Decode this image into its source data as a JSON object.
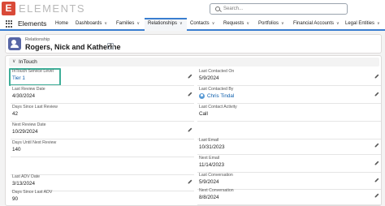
{
  "brand": {
    "logo_letter": "E",
    "logo_text": "ELEMENTS",
    "app_name": "Elements"
  },
  "search": {
    "placeholder": "Search..."
  },
  "nav": [
    {
      "label": "Home",
      "has_menu": false,
      "active": false
    },
    {
      "label": "Dashboards",
      "has_menu": true,
      "active": false
    },
    {
      "label": "Families",
      "has_menu": true,
      "active": false
    },
    {
      "label": "Relationships",
      "has_menu": true,
      "active": true
    },
    {
      "label": "Contacts",
      "has_menu": true,
      "active": false
    },
    {
      "label": "Requests",
      "has_menu": true,
      "active": false
    },
    {
      "label": "Portfolios",
      "has_menu": true,
      "active": false
    },
    {
      "label": "Financial Accounts",
      "has_menu": true,
      "active": false
    },
    {
      "label": "Legal Entities",
      "has_menu": true,
      "active": false
    }
  ],
  "record": {
    "type": "Relationship",
    "title": "Rogers, Nick and Katherine",
    "hierarchy_label": "A"
  },
  "section": {
    "label": "InTouch"
  },
  "left_fields": [
    {
      "label": "InTouch Service Level",
      "value": "Tier 1",
      "link": true,
      "editable": true
    },
    {
      "label": "Last Review Date",
      "value": "4/30/2024",
      "link": false,
      "editable": true
    },
    {
      "label": "Days Since Last Review",
      "value": "42",
      "link": false,
      "editable": false
    },
    {
      "label": "Next Review Date",
      "value": "10/29/2024",
      "link": false,
      "editable": true
    },
    {
      "label": "Days Until Next Review",
      "value": "140",
      "link": false,
      "editable": false
    },
    {
      "label": "",
      "value": "",
      "link": false,
      "editable": false
    },
    {
      "label": "Last ADV Date",
      "value": "3/13/2024",
      "link": false,
      "editable": true
    },
    {
      "label": "Days Since Last ADV",
      "value": "90",
      "link": false,
      "editable": false
    }
  ],
  "right_fields": [
    {
      "label": "Last Contacted On",
      "value": "5/9/2024",
      "link": false,
      "editable": true
    },
    {
      "label": "Last Contacted By",
      "value": "Chris Tindal",
      "link": true,
      "editable": true,
      "user_icon": true
    },
    {
      "label": "Last Contact Activity",
      "value": "Call",
      "link": false,
      "editable": false
    },
    {
      "label": "",
      "value": "",
      "link": false,
      "editable": false
    },
    {
      "label": "Last Email",
      "value": "10/31/2023",
      "link": false,
      "editable": true
    },
    {
      "label": "Next Email",
      "value": "11/14/2023",
      "link": false,
      "editable": true
    },
    {
      "label": "Last Conversation",
      "value": "5/9/2024",
      "link": false,
      "editable": true
    },
    {
      "label": "Next Conversation",
      "value": "8/8/2024",
      "link": false,
      "editable": true
    }
  ],
  "colors": {
    "brand": "#d94a38",
    "link": "#0b5cab",
    "nav_accent": "#3a7ed0",
    "highlight": "#3fae98"
  }
}
